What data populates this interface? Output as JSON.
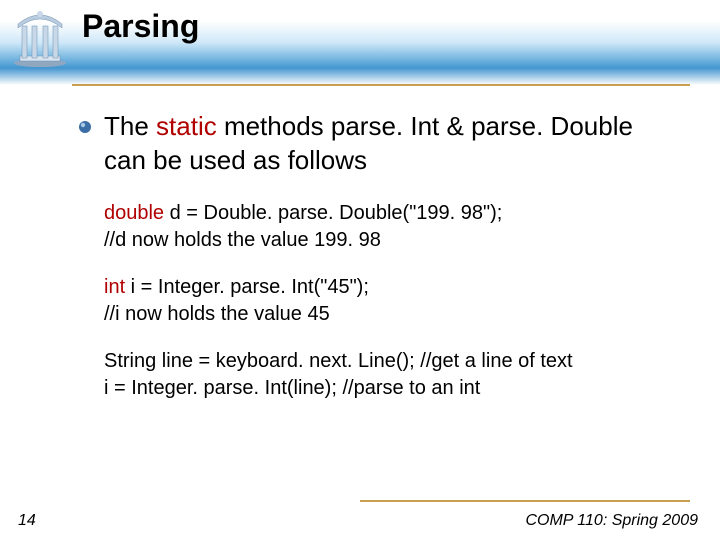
{
  "title": "Parsing",
  "bullet": {
    "pre": "The ",
    "em": "static",
    "post": " methods parse. Int & parse. Double can be used as follows"
  },
  "code1": {
    "kw": "double",
    "l1": " d = Double. parse. Double(\"199. 98\");",
    "l2": "//d now holds the value 199. 98"
  },
  "code2": {
    "kw": "int",
    "l1": " i = Integer. parse. Int(\"45\");",
    "l2": "//i now holds the value 45"
  },
  "code3": {
    "l1": "String line = keyboard. next. Line(); //get a line of text",
    "l2": "i = Integer. parse. Int(line); //parse to an int"
  },
  "page_number": "14",
  "course": "COMP 110: Spring 2009"
}
